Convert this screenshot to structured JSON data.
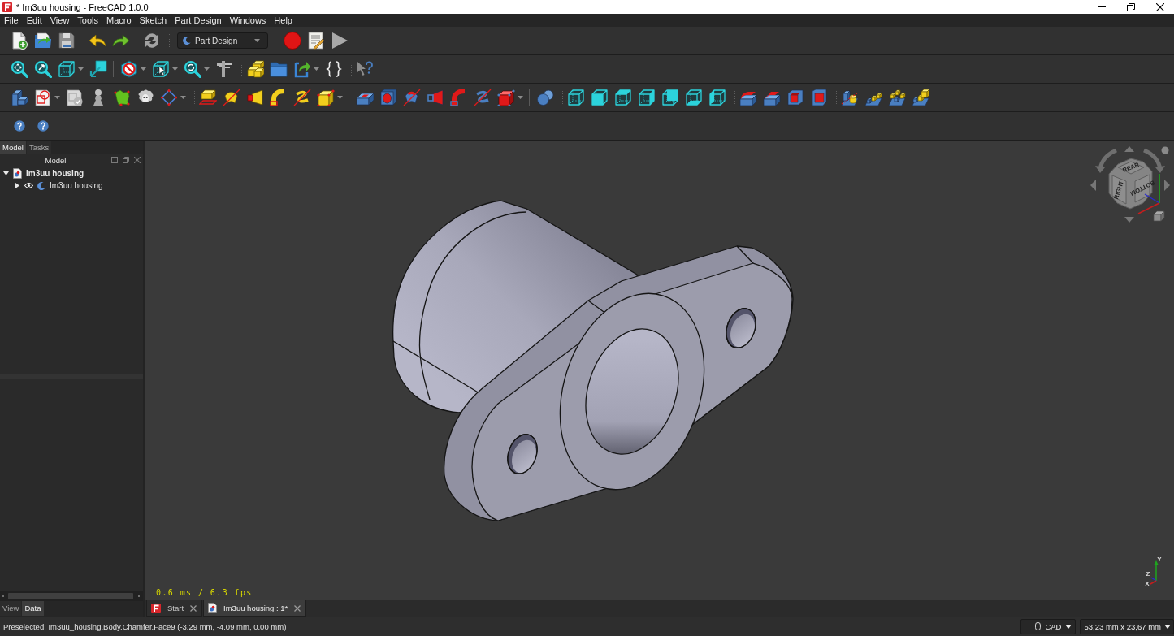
{
  "window": {
    "title": "* Im3uu housing - FreeCAD 1.0.0"
  },
  "menu": [
    "File",
    "Edit",
    "View",
    "Tools",
    "Macro",
    "Sketch",
    "Part Design",
    "Windows",
    "Help"
  ],
  "toolbar": {
    "workbench": "Part Design"
  },
  "model_panel": {
    "tabs": [
      {
        "label": "Model",
        "selected": true
      },
      {
        "label": "Tasks",
        "selected": false
      }
    ],
    "title": "Model",
    "tree": [
      {
        "label": "Im3uu housing",
        "kind": "document",
        "expanded": true,
        "children": [
          {
            "label": "Im3uu housing",
            "kind": "body",
            "expanded": false,
            "visible": true
          }
        ]
      }
    ]
  },
  "property_panel": {
    "tabs": [
      {
        "label": "View",
        "selected": false
      },
      {
        "label": "Data",
        "selected": true
      }
    ]
  },
  "viewport": {
    "fps": "0.6 ms / 6.3 fps",
    "navigation_cube": {
      "faces": [
        "REAR",
        "RIGHT",
        "BOTTOM"
      ]
    },
    "axis_labels": [
      "X",
      "Y",
      "Z"
    ]
  },
  "document_tabs": [
    {
      "label": "Start",
      "kind": "start",
      "selected": false
    },
    {
      "label": "Im3uu housing : 1*",
      "kind": "document",
      "selected": true
    }
  ],
  "status_bar": {
    "message": "Preselected: Im3uu_housing.Body.Chamfer.Face9 (-3.29 mm, -4.09 mm, 0.00 mm)",
    "navigation_style": "CAD",
    "dimensions": "53,23 mm x 23,67 mm"
  }
}
